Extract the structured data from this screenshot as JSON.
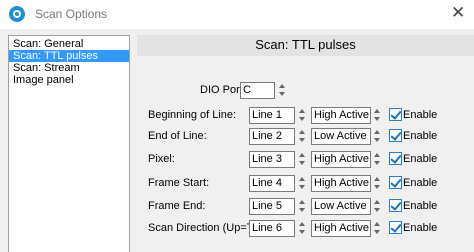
{
  "window": {
    "title": "Scan Options",
    "close_glyph": "✕"
  },
  "sidebar": {
    "items": [
      {
        "label": "Scan: General",
        "selected": false
      },
      {
        "label": "Scan: TTL pulses",
        "selected": true
      },
      {
        "label": "Scan: Stream",
        "selected": false
      },
      {
        "label": "Image panel",
        "selected": false
      }
    ]
  },
  "panel": {
    "title": "Scan: TTL pulses",
    "dio_port": {
      "label": "DIO Port",
      "value": "C"
    },
    "enable_label": "Enable",
    "rows": [
      {
        "label": "Beginning of Line:",
        "line": "Line 1",
        "polarity": "High Active",
        "enabled": true
      },
      {
        "label": "End of Line:",
        "line": "Line 2",
        "polarity": "Low Active",
        "enabled": true
      },
      {
        "label": "Pixel:",
        "line": "Line 3",
        "polarity": "High Active",
        "enabled": true
      },
      {
        "label": "Frame Start:",
        "line": "Line 4",
        "polarity": "High Active",
        "enabled": true
      },
      {
        "label": "Frame End:",
        "line": "Line 5",
        "polarity": "Low Active",
        "enabled": true
      },
      {
        "label": "Scan Direction (Up=T):",
        "line": "Line 6",
        "polarity": "High Active",
        "enabled": true
      }
    ]
  },
  "colors": {
    "selection": "#3399ff",
    "check": "#1a6fc4",
    "panel_header": "#e3e3e3"
  }
}
